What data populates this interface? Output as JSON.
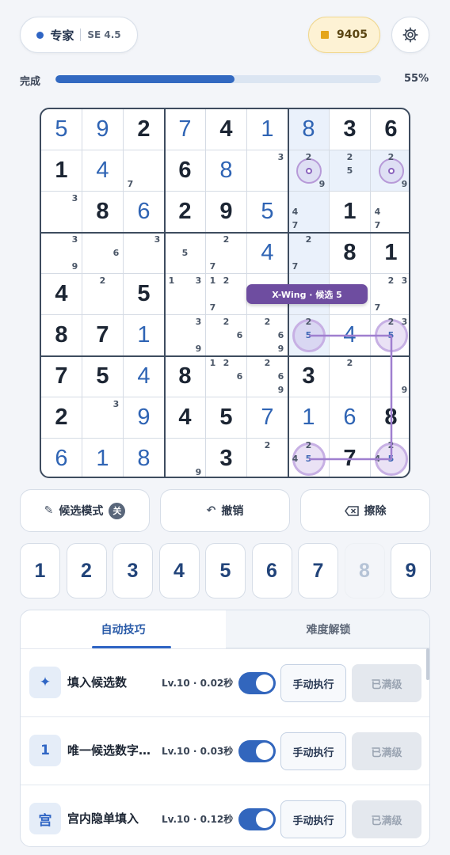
{
  "header": {
    "difficulty": "专家",
    "rating": "SE 4.5",
    "coins": "9405"
  },
  "progress": {
    "label": "完成",
    "value": 0.55,
    "percent_text": "55%"
  },
  "board": {
    "cells": [
      [
        5,
        9,
        2,
        7,
        4,
        1,
        8,
        3,
        6
      ],
      [
        1,
        4,
        0,
        6,
        8,
        0,
        0,
        0,
        0
      ],
      [
        0,
        8,
        6,
        2,
        9,
        5,
        0,
        1,
        0
      ],
      [
        0,
        0,
        0,
        0,
        0,
        4,
        0,
        8,
        1
      ],
      [
        4,
        0,
        5,
        0,
        0,
        0,
        0,
        0,
        0
      ],
      [
        8,
        7,
        1,
        0,
        0,
        0,
        0,
        4,
        0
      ],
      [
        7,
        5,
        4,
        8,
        0,
        0,
        3,
        0,
        0
      ],
      [
        2,
        0,
        9,
        4,
        5,
        7,
        1,
        6,
        8
      ],
      [
        6,
        1,
        8,
        0,
        3,
        0,
        0,
        7,
        0
      ]
    ],
    "user_filled": [
      [
        1,
        1,
        0,
        1,
        0,
        1,
        1,
        0,
        0
      ],
      [
        0,
        1,
        0,
        0,
        1,
        0,
        0,
        0,
        0
      ],
      [
        0,
        0,
        1,
        0,
        0,
        1,
        0,
        0,
        0
      ],
      [
        0,
        0,
        0,
        0,
        0,
        1,
        0,
        0,
        0
      ],
      [
        0,
        0,
        0,
        0,
        0,
        0,
        0,
        0,
        0
      ],
      [
        0,
        0,
        1,
        0,
        0,
        0,
        0,
        1,
        0
      ],
      [
        0,
        0,
        1,
        0,
        0,
        0,
        0,
        0,
        0
      ],
      [
        0,
        0,
        1,
        0,
        0,
        1,
        1,
        1,
        0
      ],
      [
        1,
        1,
        1,
        0,
        0,
        0,
        0,
        0,
        0
      ]
    ],
    "candidates": [
      [
        [
          1,
          2,
          [
            7
          ]
        ],
        [
          1,
          5,
          [
            3
          ]
        ],
        [
          1,
          6,
          [
            2,
            9
          ]
        ],
        [
          1,
          7,
          [
            2,
            5
          ]
        ],
        [
          1,
          8,
          [
            2,
            9
          ]
        ]
      ],
      [
        [
          2,
          0,
          [
            3
          ]
        ],
        [
          2,
          6,
          [
            4,
            7
          ]
        ],
        [
          2,
          8,
          [
            4,
            7
          ]
        ]
      ],
      [
        [
          3,
          0,
          [
            3,
            9
          ]
        ],
        [
          3,
          1,
          [
            6
          ]
        ],
        [
          3,
          2,
          [
            3
          ]
        ],
        [
          3,
          3,
          [
            5
          ]
        ],
        [
          3,
          4,
          [
            2,
            7
          ]
        ],
        [
          3,
          6,
          [
            2,
            7
          ]
        ]
      ],
      [
        [
          4,
          1,
          [
            2
          ]
        ],
        [
          4,
          3,
          [
            1,
            3
          ]
        ],
        [
          4,
          4,
          [
            1,
            2,
            7
          ]
        ],
        [
          4,
          8,
          [
            2,
            3,
            7
          ]
        ]
      ],
      [
        [
          5,
          3,
          [
            3,
            9
          ]
        ],
        [
          5,
          4,
          [
            2,
            6
          ]
        ],
        [
          5,
          5,
          [
            2,
            6,
            9
          ]
        ],
        [
          5,
          6,
          [
            2,
            5
          ]
        ],
        [
          5,
          8,
          [
            2,
            3,
            5
          ]
        ]
      ],
      [
        [
          6,
          4,
          [
            1,
            2,
            6
          ]
        ],
        [
          6,
          5,
          [
            2,
            6,
            9
          ]
        ],
        [
          6,
          7,
          [
            2
          ]
        ],
        [
          6,
          8,
          [
            9
          ]
        ]
      ],
      [
        [
          7,
          1,
          [
            3
          ]
        ]
      ],
      [
        [
          8,
          3,
          [
            9
          ]
        ],
        [
          8,
          5,
          [
            2
          ]
        ],
        [
          8,
          6,
          [
            2,
            4,
            5
          ]
        ],
        [
          8,
          8,
          [
            2,
            4,
            5
          ]
        ]
      ]
    ],
    "highlight_digit": 5,
    "targets": [
      [
        1,
        6
      ],
      [
        1,
        8
      ]
    ],
    "xwing_cells": [
      [
        5,
        6
      ],
      [
        5,
        8
      ],
      [
        8,
        6
      ],
      [
        8,
        8
      ]
    ],
    "hint_label": "X-Wing · 候选 5"
  },
  "actions": {
    "pencil": "候选模式",
    "pencil_state": "关",
    "undo": "撤销",
    "erase": "擦除"
  },
  "numpad": [
    "1",
    "2",
    "3",
    "4",
    "5",
    "6",
    "7",
    "8",
    "9"
  ],
  "numpad_completed": [
    "8"
  ],
  "tabs": {
    "auto": "自动技巧",
    "unlock": "难度解锁"
  },
  "skills": [
    {
      "icon": "✦",
      "name": "填入候选数",
      "level": "Lv.10 · 0.02秒",
      "enabled": true,
      "run": "手动执行",
      "status": "已满级"
    },
    {
      "icon": "1",
      "name": "唯一候选数字填入",
      "level": "Lv.10 · 0.03秒",
      "enabled": true,
      "run": "手动执行",
      "status": "已满级"
    },
    {
      "icon": "宫",
      "name": "宫内隐单填入",
      "level": "Lv.10 · 0.12秒",
      "enabled": true,
      "run": "手动执行",
      "status": "已满级"
    }
  ],
  "icons": {
    "settings": "gear-icon",
    "pencil": "pencil-icon",
    "undo": "undo-icon",
    "erase": "backspace-icon",
    "coin": "coin-icon"
  },
  "colors": {
    "accent": "#2f65c4",
    "xwing": "#8a63bd",
    "coin": "#e5a61b"
  }
}
